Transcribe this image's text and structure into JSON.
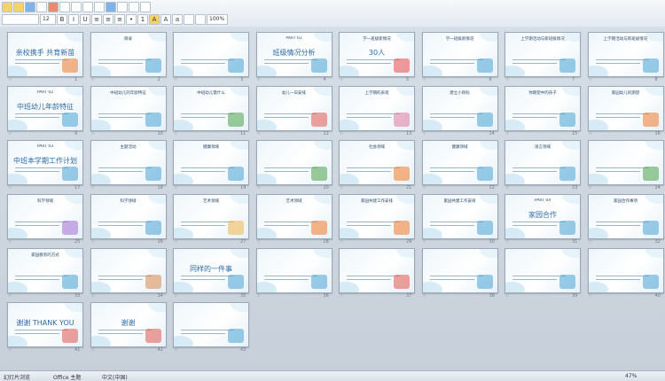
{
  "toolbar": {
    "font_size": "12",
    "zoom": "100%"
  },
  "slides": [
    {
      "n": "1",
      "title": "",
      "big": "亲校携手 共育新苗",
      "accent": "#f07a2a"
    },
    {
      "n": "2",
      "title": "目录",
      "big": "",
      "accent": "#49a4d6"
    },
    {
      "n": "3",
      "title": "",
      "big": "",
      "accent": "#49a4d6"
    },
    {
      "n": "4",
      "title": "PART 01",
      "big": "班级情况分析",
      "accent": "#49a4d6"
    },
    {
      "n": "5",
      "title": "学一班级新情况",
      "big": "30人",
      "accent": "#e94b4b"
    },
    {
      "n": "6",
      "title": "学一班级新情况",
      "big": "",
      "accent": "#49a4d6"
    },
    {
      "n": "7",
      "title": "上学期活动与新班级情况",
      "big": "",
      "accent": "#49a4d6"
    },
    {
      "n": "8",
      "title": "上学期活动与新班级情况",
      "big": "",
      "accent": "#49a4d6"
    },
    {
      "n": "9",
      "title": "PART 02",
      "big": "中班幼儿年龄特征",
      "accent": "#49a4d6"
    },
    {
      "n": "10",
      "title": "中班幼儿的年龄特征",
      "big": "",
      "accent": "#49a4d6"
    },
    {
      "n": "11",
      "title": "中班幼儿需什么",
      "big": "",
      "accent": "#4aa34a"
    },
    {
      "n": "12",
      "title": "幼儿一日安排",
      "big": "",
      "accent": "#e2574c"
    },
    {
      "n": "13",
      "title": "上学期的表现",
      "big": "",
      "accent": "#e07aa0"
    },
    {
      "n": "14",
      "title": "建立小目标",
      "big": "",
      "accent": "#49a4d6"
    },
    {
      "n": "15",
      "title": "你期望中的孩子",
      "big": "",
      "accent": "#49a4d6"
    },
    {
      "n": "16",
      "title": "家园幼儿的期望",
      "big": "",
      "accent": "#f07a2a"
    },
    {
      "n": "17",
      "title": "PART 03",
      "big": "中班本学期工作计划",
      "accent": "#49a4d6"
    },
    {
      "n": "18",
      "title": "主题活动",
      "big": "",
      "accent": "#49a4d6"
    },
    {
      "n": "19",
      "title": "健康领域",
      "big": "",
      "accent": "#49a4d6"
    },
    {
      "n": "20",
      "title": "",
      "big": "",
      "accent": "#4aa34a"
    },
    {
      "n": "21",
      "title": "社会领域",
      "big": "",
      "accent": "#f07a2a"
    },
    {
      "n": "22",
      "title": "健康领域",
      "big": "",
      "accent": "#49a4d6"
    },
    {
      "n": "23",
      "title": "语言领域",
      "big": "",
      "accent": "#49a4d6"
    },
    {
      "n": "24",
      "title": "",
      "big": "",
      "accent": "#4aa34a"
    },
    {
      "n": "25",
      "title": "科学领域",
      "big": "",
      "accent": "#a36bd6"
    },
    {
      "n": "26",
      "title": "科学领域",
      "big": "",
      "accent": "#49a4d6"
    },
    {
      "n": "27",
      "title": "艺术领域",
      "big": "",
      "accent": "#f0b64a"
    },
    {
      "n": "28",
      "title": "艺术领域",
      "big": "",
      "accent": "#f07a2a"
    },
    {
      "n": "29",
      "title": "家园共建工作安排",
      "big": "",
      "accent": "#f07a2a"
    },
    {
      "n": "30",
      "title": "家园共建工作安排",
      "big": "",
      "accent": "#49a4d6"
    },
    {
      "n": "31",
      "title": "PART 04",
      "big": "家园合作",
      "accent": "#49a4d6"
    },
    {
      "n": "32",
      "title": "家园合作事项",
      "big": "",
      "accent": "#49a4d6"
    },
    {
      "n": "33",
      "title": "家园教育的方式",
      "big": "",
      "accent": "#49a4d6"
    },
    {
      "n": "34",
      "title": "",
      "big": "",
      "accent": "#d98a4a"
    },
    {
      "n": "35",
      "title": "",
      "big": "同样的一件事",
      "accent": "#49a4d6"
    },
    {
      "n": "36",
      "title": "",
      "big": "",
      "accent": "#49a4d6"
    },
    {
      "n": "37",
      "title": "",
      "big": "",
      "accent": "#e2574c"
    },
    {
      "n": "38",
      "title": "",
      "big": "",
      "accent": "#49a4d6"
    },
    {
      "n": "39",
      "title": "",
      "big": "",
      "accent": "#49a4d6"
    },
    {
      "n": "40",
      "title": "",
      "big": "",
      "accent": "#49a4d6"
    },
    {
      "n": "41",
      "title": "",
      "big": "谢谢 THANK YOU",
      "accent": "#e2574c"
    },
    {
      "n": "42",
      "title": "",
      "big": "谢谢",
      "accent": "#e2574c"
    },
    {
      "n": "43",
      "title": "",
      "big": "",
      "accent": "#49a4d6"
    }
  ],
  "status": {
    "left": "幻灯片浏览",
    "theme": "Office 主题",
    "lang": "中文(中国)",
    "zoom": "47%"
  }
}
